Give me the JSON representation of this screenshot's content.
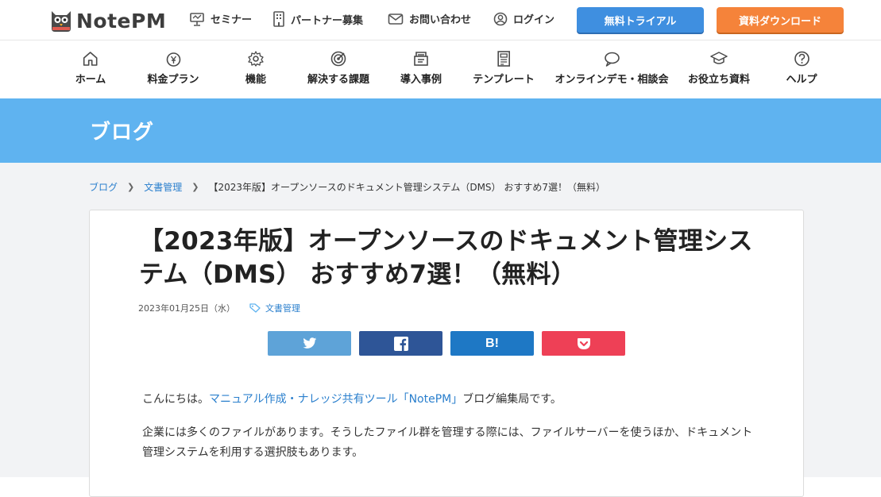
{
  "brand": {
    "name": "NotePM"
  },
  "topbar": {
    "seminar": "セミナー",
    "partner": "パートナー募集",
    "contact": "お問い合わせ",
    "login": "ログイン",
    "trial_button": "無料トライアル",
    "download_button": "資料ダウンロード"
  },
  "gnav": [
    {
      "label": "ホーム",
      "icon": "home-icon"
    },
    {
      "label": "料金プラン",
      "icon": "price-icon"
    },
    {
      "label": "機能",
      "icon": "gear-icon"
    },
    {
      "label": "解決する課題",
      "icon": "target-icon"
    },
    {
      "label": "導入事例",
      "icon": "case-icon"
    },
    {
      "label": "テンプレート",
      "icon": "template-icon"
    },
    {
      "label": "オンラインデモ・相談会",
      "icon": "chat-icon"
    },
    {
      "label": "お役立ち資料",
      "icon": "graduation-icon"
    },
    {
      "label": "ヘルプ",
      "icon": "help-icon"
    }
  ],
  "hero": {
    "title": "ブログ"
  },
  "breadcrumb": {
    "items": [
      "ブログ",
      "文書管理"
    ],
    "current": "【2023年版】オープンソースのドキュメント管理システム（DMS） おすすめ7選！（無料）"
  },
  "post": {
    "title": "【2023年版】オープンソースのドキュメント管理システム（DMS） おすすめ7選！（無料）",
    "date": "2023年01月25日（水）",
    "category": "文書管理",
    "share": {
      "hatena_label": "B!"
    },
    "intro_prefix": "こんにちは。",
    "intro_link": "マニュアル作成・ナレッジ共有ツール「NotePM」",
    "intro_suffix": "ブログ編集局です。",
    "para2": "企業には多くのファイルがあります。そうしたファイル群を管理する際には、ファイルサーバーを使うほか、ドキュメント管理システムを利用する選択肢もあります。"
  },
  "colors": {
    "hero_bg": "#5fb3f0",
    "trial": "#3f8fe0",
    "download": "#f5833a",
    "twitter": "#5ea3d8",
    "facebook": "#2e5597",
    "hatena": "#1e78c5",
    "pocket": "#ee4056",
    "link": "#2a7fcd"
  }
}
